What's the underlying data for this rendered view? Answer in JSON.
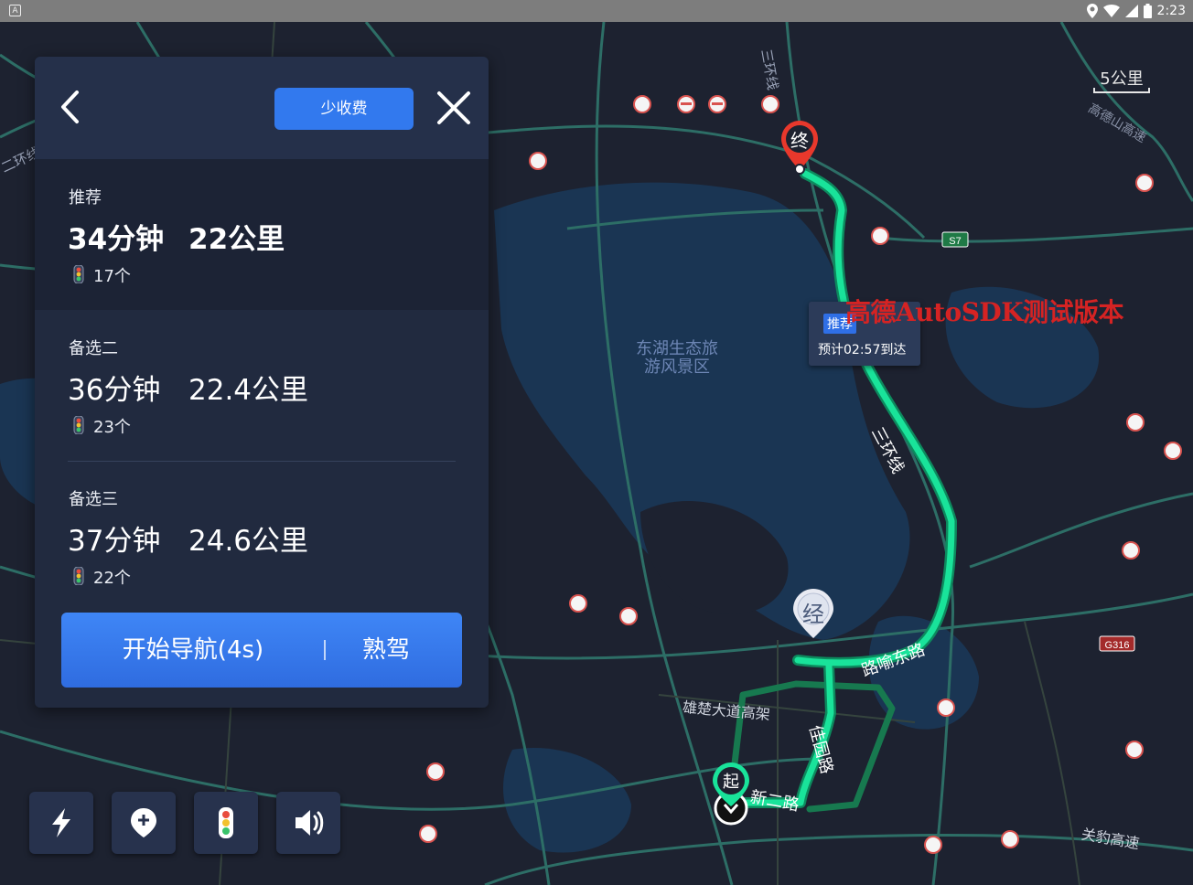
{
  "status_bar": {
    "app_icon_letter": "A",
    "time": "2:23",
    "icons": [
      "location-icon",
      "wifi-icon",
      "signal-icon",
      "battery-icon"
    ]
  },
  "map": {
    "scale_label": "5公里",
    "watermark": "高德AutoSDK测试版本",
    "callout": {
      "tag": "推荐",
      "eta": "预计02:57到达"
    },
    "pins": {
      "end": "终",
      "start": "起",
      "via": "经"
    },
    "road_labels": {
      "ring3": "三环线",
      "ring3_top": "三环线",
      "ring2": "二环线",
      "expressway_top": "高德山高速",
      "park": "东湖生态旅游风景区",
      "luyu": "路喻东路",
      "xiongchu": "雄楚大道高架",
      "jiayuan": "佳园路",
      "xiner": "新二路",
      "guanbao": "关豹高速"
    },
    "road_badges": {
      "s7": "S7",
      "g316": "G316"
    }
  },
  "panel": {
    "toll_button": "少收费",
    "routes": [
      {
        "name": "推荐",
        "time": "34分钟",
        "distance": "22公里",
        "lights": "17个"
      },
      {
        "name": "备选二",
        "time": "36分钟",
        "distance": "22.4公里",
        "lights": "23个"
      },
      {
        "name": "备选三",
        "time": "37分钟",
        "distance": "24.6公里",
        "lights": "22个"
      }
    ],
    "start_label": "开始导航(4s)",
    "familiar_label": "熟驾"
  },
  "toolbar": [
    "lightning-icon",
    "add-location-icon",
    "traffic-light-icon",
    "volume-icon"
  ],
  "colors": {
    "route": "#19e39a",
    "accent": "#3279ee",
    "panel": "#212a3f",
    "end_pin": "#e8382c"
  }
}
